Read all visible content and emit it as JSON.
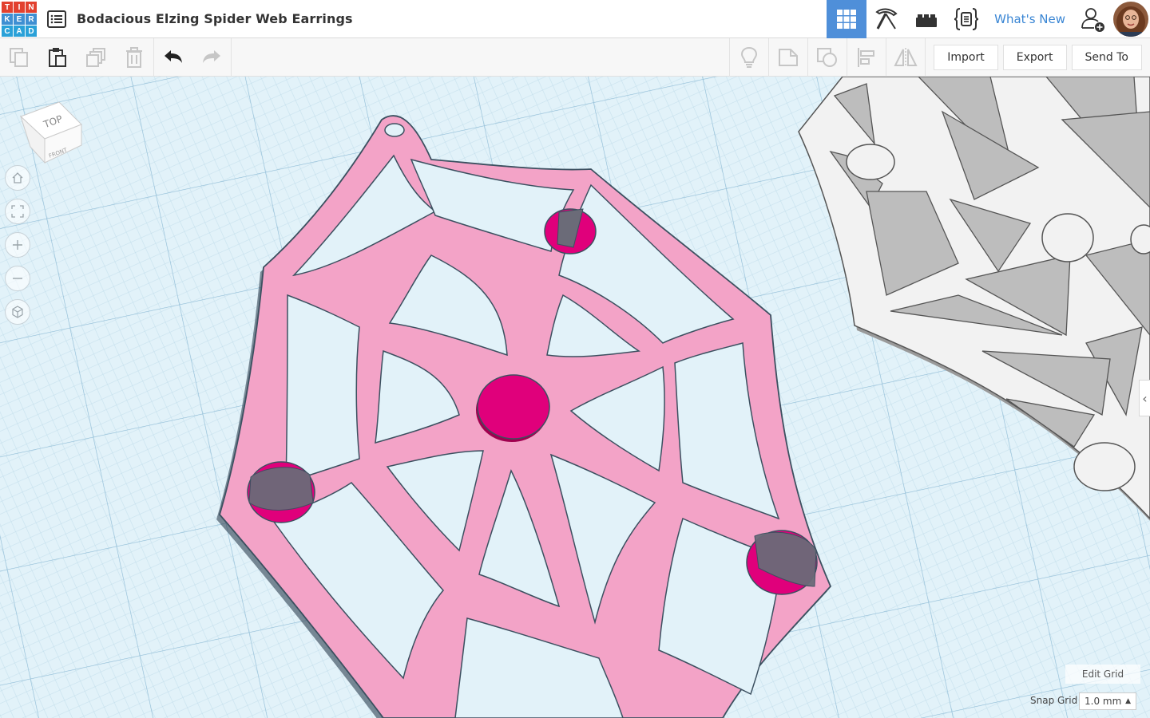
{
  "app": {
    "logo_letters": [
      "T",
      "I",
      "N",
      "K",
      "E",
      "R",
      "C",
      "A",
      "D"
    ],
    "logo_colors": [
      "#e2412f",
      "#e2412f",
      "#e2412f",
      "#3f8fd2",
      "#3f8fd2",
      "#3f8fd2",
      "#2aa1d8",
      "#2aa1d8",
      "#2aa1d8"
    ],
    "document_title": "Bodacious Elzing Spider Web Earrings"
  },
  "header": {
    "views": [
      {
        "name": "3d-design-view",
        "icon": "grid-icon",
        "active": true
      },
      {
        "name": "blocks-view",
        "icon": "pickaxe-icon",
        "active": false
      },
      {
        "name": "bricks-view",
        "icon": "brick-icon",
        "active": false
      },
      {
        "name": "codeblocks-view",
        "icon": "code-braces-icon",
        "active": false
      }
    ],
    "whats_new": "What's New",
    "accent": "#4f8fd9"
  },
  "toolbar": {
    "left_icons": [
      "copy-icon",
      "paste-icon",
      "duplicate-icon",
      "delete-icon",
      "undo-icon",
      "redo-icon"
    ],
    "right_icons": [
      "light-bulb-icon",
      "note-icon",
      "group-icon",
      "align-icon",
      "mirror-icon"
    ],
    "import_label": "Import",
    "export_label": "Export",
    "send_to_label": "Send To"
  },
  "viewport": {
    "view_cube_top": "TOP",
    "view_cube_front": "FRONT",
    "nav_icons": [
      "home-icon",
      "fit-icon",
      "zoom-in-icon",
      "zoom-out-icon",
      "perspective-icon"
    ],
    "edit_grid_label": "Edit Grid",
    "snap_grid_label": "Snap Grid",
    "snap_grid_value": "1.0 mm",
    "shape_colors": {
      "pink": "#f3a3c7",
      "magenta": "#e0007b",
      "grey": "#f2f2f2"
    }
  }
}
